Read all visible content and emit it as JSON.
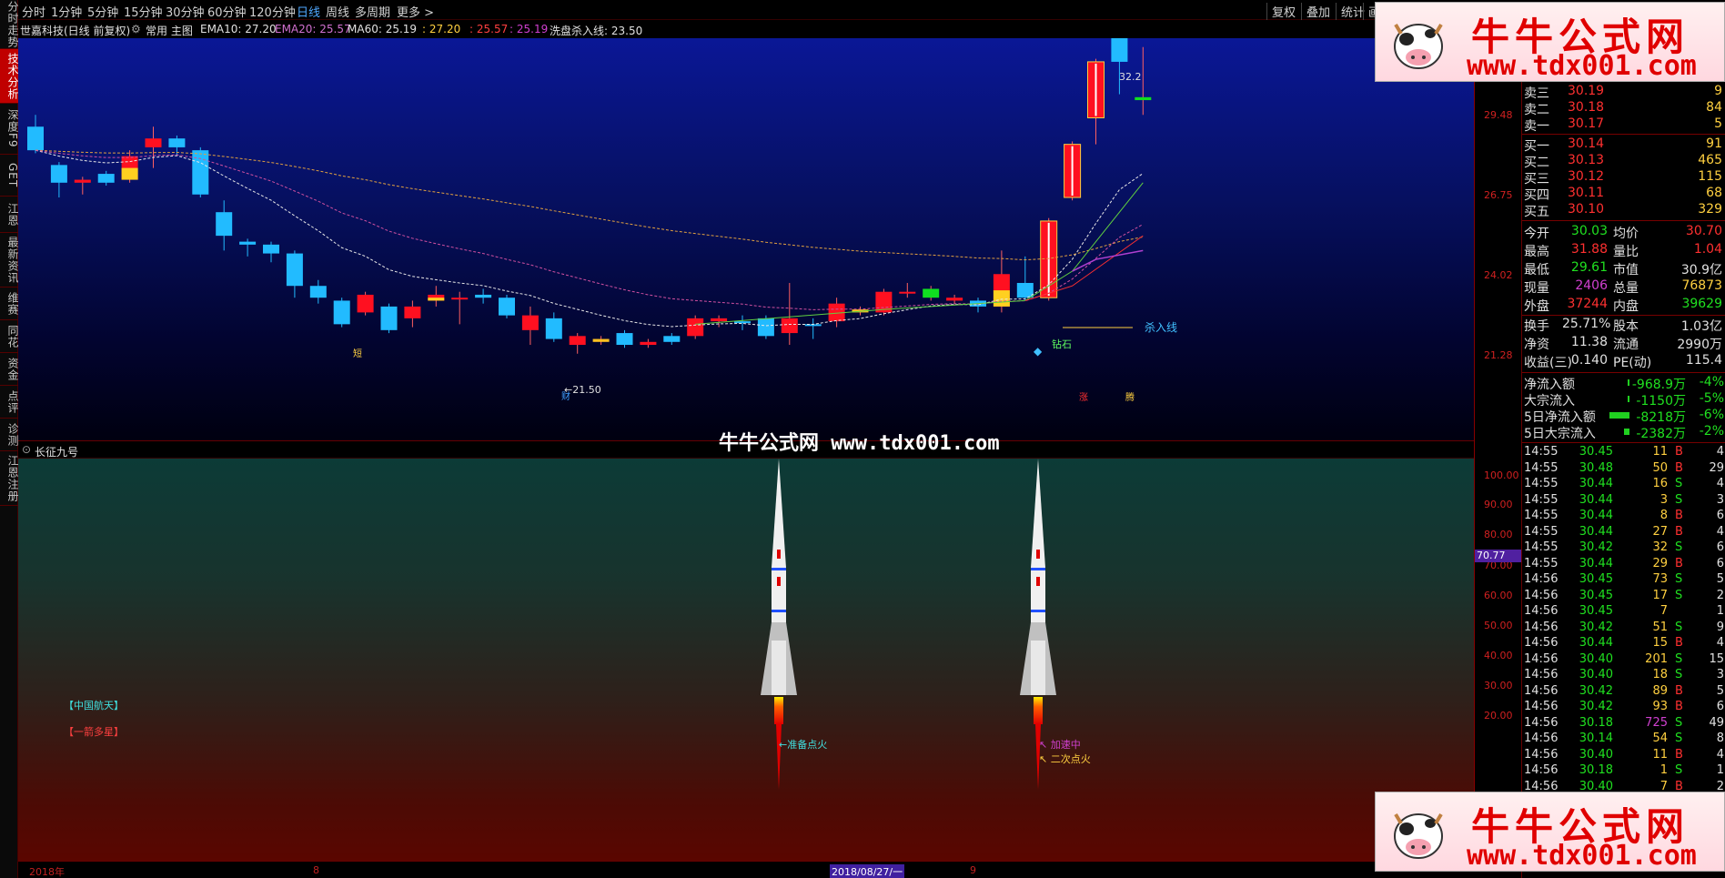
{
  "left_tabs": [
    "分时走势",
    "技术分析",
    "深度F9",
    "GET",
    "江恩",
    "最新资讯",
    "维赛",
    "同花",
    "资金",
    "点评",
    "诊测",
    "江恩注册"
  ],
  "left_tabs_active": 1,
  "toolbar": {
    "periods": [
      "分时",
      "1分钟",
      "5分钟",
      "15分钟",
      "30分钟",
      "60分钟",
      "120分钟",
      "日线",
      "周线",
      "多周期",
      "更多 >"
    ],
    "active_period": "日线",
    "right_items": [
      "复权",
      "叠加",
      "统计",
      "画"
    ]
  },
  "stock_line": {
    "name": "世嘉科技(日线 前复权)",
    "mode": "常用 主图",
    "indicators": [
      {
        "text": "EMA10: 27.20",
        "color": "#e0e0e0"
      },
      {
        "text": "EMA20: 25.57",
        "color": "#d070d0"
      },
      {
        "text": "MA60: 25.19",
        "color": "#e0e0e0"
      },
      {
        "text": ": 27.20",
        "color": "#ffd040"
      },
      {
        "text": ": 25.57",
        "color": "#ff4040"
      },
      {
        "text": ": 25.19",
        "color": "#d040d0"
      },
      {
        "text": "洗盘杀入线: 23.50",
        "color": "#e0e0e0"
      }
    ]
  },
  "main_chart": {
    "y_ticks": [
      "29.48",
      "26.75",
      "24.02",
      "21.28"
    ],
    "annotations": {
      "high": "32.2",
      "low": "←21.50",
      "kill_line": "杀入线",
      "diamond": "钻石",
      "short": "短",
      "cai": "财",
      "zhang": "涨",
      "teng": "腾"
    },
    "candles": [
      {
        "o": 29.2,
        "c": 28.4,
        "h": 29.6,
        "l": 28.3,
        "style": "blue"
      },
      {
        "o": 27.9,
        "c": 27.3,
        "h": 28.0,
        "l": 26.8,
        "style": "blue"
      },
      {
        "o": 27.3,
        "c": 27.4,
        "h": 27.5,
        "l": 26.9,
        "style": "red"
      },
      {
        "o": 27.3,
        "c": 27.6,
        "h": 27.7,
        "l": 27.2,
        "style": "blue"
      },
      {
        "o": 27.4,
        "c": 28.2,
        "h": 28.4,
        "l": 27.3,
        "style": "yellowred"
      },
      {
        "o": 28.5,
        "c": 28.8,
        "h": 29.2,
        "l": 27.8,
        "style": "red"
      },
      {
        "o": 28.8,
        "c": 28.5,
        "h": 28.9,
        "l": 28.2,
        "style": "blue"
      },
      {
        "o": 28.4,
        "c": 26.9,
        "h": 28.5,
        "l": 26.8,
        "style": "blue"
      },
      {
        "o": 26.3,
        "c": 25.5,
        "h": 26.7,
        "l": 25.0,
        "style": "blue"
      },
      {
        "o": 25.3,
        "c": 25.2,
        "h": 25.4,
        "l": 24.8,
        "style": "blue"
      },
      {
        "o": 25.2,
        "c": 24.9,
        "h": 25.3,
        "l": 24.6,
        "style": "blue"
      },
      {
        "o": 24.9,
        "c": 23.8,
        "h": 25.0,
        "l": 23.4,
        "style": "blue"
      },
      {
        "o": 23.8,
        "c": 23.4,
        "h": 24.0,
        "l": 23.2,
        "style": "blue"
      },
      {
        "o": 23.3,
        "c": 22.5,
        "h": 23.4,
        "l": 22.4,
        "style": "blue"
      },
      {
        "o": 22.9,
        "c": 23.5,
        "h": 23.6,
        "l": 22.8,
        "style": "red"
      },
      {
        "o": 23.1,
        "c": 22.3,
        "h": 23.2,
        "l": 22.2,
        "style": "blue"
      },
      {
        "o": 22.7,
        "c": 23.1,
        "h": 23.3,
        "l": 22.4,
        "style": "red"
      },
      {
        "o": 23.3,
        "c": 23.5,
        "h": 23.8,
        "l": 23.1,
        "style": "yellowred"
      },
      {
        "o": 23.4,
        "c": 23.4,
        "h": 23.6,
        "l": 22.5,
        "style": "red"
      },
      {
        "o": 23.5,
        "c": 23.4,
        "h": 23.7,
        "l": 23.2,
        "style": "blue"
      },
      {
        "o": 23.4,
        "c": 22.8,
        "h": 23.5,
        "l": 22.7,
        "style": "blue"
      },
      {
        "o": 22.3,
        "c": 22.8,
        "h": 23.1,
        "l": 21.8,
        "style": "red"
      },
      {
        "o": 22.7,
        "c": 22.0,
        "h": 22.9,
        "l": 21.9,
        "style": "blue"
      },
      {
        "o": 21.8,
        "c": 22.1,
        "h": 22.2,
        "l": 21.5,
        "style": "red"
      },
      {
        "o": 22.0,
        "c": 21.9,
        "h": 22.1,
        "l": 21.8,
        "style": "yellow"
      },
      {
        "o": 22.2,
        "c": 21.8,
        "h": 22.3,
        "l": 21.7,
        "style": "blue"
      },
      {
        "o": 21.8,
        "c": 21.9,
        "h": 22.0,
        "l": 21.7,
        "style": "red"
      },
      {
        "o": 21.9,
        "c": 22.1,
        "h": 22.2,
        "l": 21.8,
        "style": "blue"
      },
      {
        "o": 22.1,
        "c": 22.7,
        "h": 22.8,
        "l": 22.0,
        "style": "red"
      },
      {
        "o": 22.6,
        "c": 22.7,
        "h": 22.8,
        "l": 22.4,
        "style": "red"
      },
      {
        "o": 22.6,
        "c": 22.6,
        "h": 22.8,
        "l": 22.3,
        "style": "blue"
      },
      {
        "o": 22.7,
        "c": 22.1,
        "h": 22.8,
        "l": 22.0,
        "style": "blue"
      },
      {
        "o": 22.2,
        "c": 22.7,
        "h": 23.9,
        "l": 21.8,
        "style": "red"
      },
      {
        "o": 22.5,
        "c": 22.5,
        "h": 22.7,
        "l": 22.0,
        "style": "blue"
      },
      {
        "o": 22.6,
        "c": 23.2,
        "h": 23.4,
        "l": 22.4,
        "style": "red"
      },
      {
        "o": 22.9,
        "c": 23.0,
        "h": 23.1,
        "l": 22.8,
        "style": "yellow"
      },
      {
        "o": 22.9,
        "c": 23.6,
        "h": 23.7,
        "l": 22.8,
        "style": "red"
      },
      {
        "o": 23.6,
        "c": 23.6,
        "h": 23.9,
        "l": 23.4,
        "style": "red"
      },
      {
        "o": 23.4,
        "c": 23.7,
        "h": 23.8,
        "l": 23.3,
        "style": "green"
      },
      {
        "o": 23.3,
        "c": 23.4,
        "h": 23.5,
        "l": 23.2,
        "style": "red"
      },
      {
        "o": 23.3,
        "c": 23.1,
        "h": 23.4,
        "l": 22.9,
        "style": "blue"
      },
      {
        "o": 23.1,
        "c": 24.2,
        "h": 25.0,
        "l": 22.9,
        "style": "yellowred"
      },
      {
        "o": 23.9,
        "c": 23.4,
        "h": 24.8,
        "l": 23.3,
        "style": "blue"
      },
      {
        "o": 23.4,
        "c": 26.0,
        "h": 26.1,
        "l": 23.3,
        "style": "boxred"
      },
      {
        "o": 26.8,
        "c": 28.6,
        "h": 28.7,
        "l": 26.7,
        "style": "boxred"
      },
      {
        "o": 29.5,
        "c": 31.4,
        "h": 31.5,
        "l": 28.6,
        "style": "boxred"
      },
      {
        "o": 31.4,
        "c": 32.2,
        "h": 32.2,
        "l": 30.3,
        "style": "blue"
      },
      {
        "o": 30.2,
        "c": 30.1,
        "h": 31.9,
        "l": 29.6,
        "style": "green"
      }
    ]
  },
  "sub_chart": {
    "title": "长征九号",
    "y_ticks": [
      "100.00",
      "90.00",
      "80.00",
      "70.00",
      "60.00",
      "50.00",
      "40.00",
      "30.00",
      "20.00"
    ],
    "value_tag": "70.77",
    "labels": {
      "aerospace": "【中国航天】",
      "multi_star": "【一箭多星】",
      "ready": "←准备点火",
      "accel": "↖ 加速中",
      "second": "↖ 二次点火"
    }
  },
  "date_bar": {
    "year": "2018年",
    "m8": "8",
    "current": "2018/08/27/一",
    "m9": "9"
  },
  "watermark": "牛牛公式网 www.tdx001.com",
  "logo": {
    "title": "牛牛公式网",
    "url": "www.tdx001.com"
  },
  "order_book": {
    "asks": [
      {
        "label": "卖三",
        "price": "30.19",
        "vol": "9"
      },
      {
        "label": "卖二",
        "price": "30.18",
        "vol": "84"
      },
      {
        "label": "卖一",
        "price": "30.17",
        "vol": "5"
      }
    ],
    "bids": [
      {
        "label": "买一",
        "price": "30.14",
        "vol": "91"
      },
      {
        "label": "买二",
        "price": "30.13",
        "vol": "465"
      },
      {
        "label": "买三",
        "price": "30.12",
        "vol": "115"
      },
      {
        "label": "买四",
        "price": "30.11",
        "vol": "68"
      },
      {
        "label": "买五",
        "price": "30.10",
        "vol": "329"
      }
    ]
  },
  "quote": [
    {
      "l1": "今开",
      "v1": "30.03",
      "c1": "#20e020",
      "l2": "均价",
      "v2": "30.70",
      "c2": "#ff3030"
    },
    {
      "l1": "最高",
      "v1": "31.88",
      "c1": "#ff3030",
      "l2": "量比",
      "v2": "1.04",
      "c2": "#ff3030"
    },
    {
      "l1": "最低",
      "v1": "29.61",
      "c1": "#20e020",
      "l2": "市值",
      "v2": "30.9亿",
      "c2": "#e0e0e0"
    },
    {
      "l1": "现量",
      "v1": "2406",
      "c1": "#d040d0",
      "l2": "总量",
      "v2": "76873",
      "c2": "#ffd040"
    },
    {
      "l1": "外盘",
      "v1": "37244",
      "c1": "#ff3030",
      "l2": "内盘",
      "v2": "39629",
      "c2": "#20e020"
    },
    {
      "l1": "换手",
      "v1": "25.71%",
      "c1": "#e0e0e0",
      "l2": "股本",
      "v2": "1.03亿",
      "c2": "#e0e0e0"
    },
    {
      "l1": "净资",
      "v1": "11.38",
      "c1": "#e0e0e0",
      "l2": "流通",
      "v2": "2990万",
      "c2": "#e0e0e0"
    },
    {
      "l1": "收益(三)",
      "v1": "0.140",
      "c1": "#e0e0e0",
      "l2": "PE(动)",
      "v2": "115.4",
      "c2": "#e0e0e0"
    }
  ],
  "flows": [
    {
      "label": "净流入额",
      "value": "-968.9万",
      "pct": "-4%",
      "bar": 2
    },
    {
      "label": "大宗流入",
      "value": "-1150万",
      "pct": "-5%",
      "bar": 2
    },
    {
      "label": "5日净流入额",
      "value": "-8218万",
      "pct": "-6%",
      "bar": 22
    },
    {
      "label": "5日大宗流入",
      "value": "-2382万",
      "pct": "-2%",
      "bar": 6
    }
  ],
  "ticks": [
    {
      "t": "14:55",
      "p": "30.45",
      "v": "11",
      "bs": "B",
      "n": "4"
    },
    {
      "t": "14:55",
      "p": "30.48",
      "v": "50",
      "bs": "B",
      "n": "29"
    },
    {
      "t": "14:55",
      "p": "30.44",
      "v": "16",
      "bs": "S",
      "n": "4"
    },
    {
      "t": "14:55",
      "p": "30.44",
      "v": "3",
      "bs": "S",
      "n": "3"
    },
    {
      "t": "14:55",
      "p": "30.44",
      "v": "8",
      "bs": "B",
      "n": "6"
    },
    {
      "t": "14:55",
      "p": "30.44",
      "v": "27",
      "bs": "B",
      "n": "4"
    },
    {
      "t": "14:55",
      "p": "30.42",
      "v": "32",
      "bs": "S",
      "n": "6"
    },
    {
      "t": "14:55",
      "p": "30.44",
      "v": "29",
      "bs": "B",
      "n": "6"
    },
    {
      "t": "14:56",
      "p": "30.45",
      "v": "73",
      "bs": "S",
      "n": "5"
    },
    {
      "t": "14:56",
      "p": "30.45",
      "v": "17",
      "bs": "S",
      "n": "2"
    },
    {
      "t": "14:56",
      "p": "30.45",
      "v": "7",
      "bs": "",
      "n": "1"
    },
    {
      "t": "14:56",
      "p": "30.42",
      "v": "51",
      "bs": "S",
      "n": "9"
    },
    {
      "t": "14:56",
      "p": "30.44",
      "v": "15",
      "bs": "B",
      "n": "4"
    },
    {
      "t": "14:56",
      "p": "30.40",
      "v": "201",
      "bs": "S",
      "n": "15"
    },
    {
      "t": "14:56",
      "p": "30.40",
      "v": "18",
      "bs": "S",
      "n": "3"
    },
    {
      "t": "14:56",
      "p": "30.42",
      "v": "89",
      "bs": "B",
      "n": "5"
    },
    {
      "t": "14:56",
      "p": "30.42",
      "v": "93",
      "bs": "B",
      "n": "6"
    },
    {
      "t": "14:56",
      "p": "30.18",
      "v": "725",
      "bs": "S",
      "n": "49"
    },
    {
      "t": "14:56",
      "p": "30.14",
      "v": "54",
      "bs": "S",
      "n": "8"
    },
    {
      "t": "14:56",
      "p": "30.40",
      "v": "11",
      "bs": "B",
      "n": "4"
    },
    {
      "t": "14:56",
      "p": "30.18",
      "v": "1",
      "bs": "S",
      "n": "1"
    },
    {
      "t": "14:56",
      "p": "30.40",
      "v": "7",
      "bs": "B",
      "n": "2"
    }
  ]
}
